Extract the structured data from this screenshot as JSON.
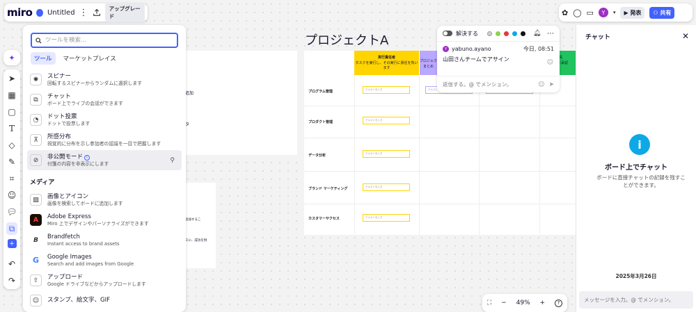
{
  "app": {
    "logo": "miro",
    "board_title": "Untitled",
    "upgrade_label": "アップグレード"
  },
  "topright": {
    "avatar_letter": "Y",
    "present_label": "発表",
    "share_label": "共有"
  },
  "tools": {
    "search_placeholder": "ツールを検索...",
    "tabs": [
      "ツール",
      "マーケットプレイス"
    ],
    "items": [
      {
        "name": "スピナー",
        "desc": "回転するスピナーからランダムに選択します",
        "icon": "spinner-icon"
      },
      {
        "name": "チャット",
        "desc": "ボード上でライブの会話ができます",
        "icon": "chat-icon"
      },
      {
        "name": "ドット投票",
        "desc": "ドットで投票します",
        "icon": "dot-vote-icon"
      },
      {
        "name": "所感分布",
        "desc": "視覚的に分布を示し参加者の認識を一目で把握します",
        "icon": "distribution-icon"
      },
      {
        "name": "非公開モード",
        "desc": "付箋の内容を非表示にします",
        "icon": "private-mode-icon"
      }
    ],
    "media_heading": "メディア",
    "media": [
      {
        "name": "画像とアイコン",
        "desc": "画像を検索してボードに追加します",
        "icon": "image-icon"
      },
      {
        "name": "Adobe Express",
        "desc": "Miro 上でデザインやパーソナライズができます",
        "icon": "adobe-icon"
      },
      {
        "name": "Brandfetch",
        "desc": "Instant access to brand assets",
        "icon": "brandfetch-icon"
      },
      {
        "name": "Google Images",
        "desc": "Search and add images from Google",
        "icon": "google-icon"
      },
      {
        "name": "アップロード",
        "desc": "Google ドライブなどからアップロードします",
        "icon": "upload-icon"
      },
      {
        "name": "スタンプ、絵文字、GIF",
        "desc": "",
        "icon": "stamp-icon"
      }
    ]
  },
  "board": {
    "headline": "プロジェクトA",
    "column_headers": [
      {
        "title": "実行責任者",
        "desc": "タスクを実行し、その実行に責任を負います",
        "color": "#ffd400"
      },
      {
        "title": "プロジェク",
        "desc": "まとめ",
        "color": "#b9a8ff"
      },
      {
        "title": "報告先",
        "desc": "最終的に承認",
        "color": "#20c35e"
      }
    ],
    "rows": [
      "プログラム管理",
      "プロダクト管理",
      "データ分析",
      "ブランド マーケティング",
      "カスタマーサクセス"
    ],
    "sticky_text": "テキストを入力",
    "left_card_texts": [
      "追加",
      "タ"
    ],
    "left_card2_texts": [
      "追加するこ",
      "スに、成功を例"
    ]
  },
  "comment": {
    "resolve_label": "解決する",
    "colors": [
      "#d0d0d0",
      "#8fd14f",
      "#e6393b",
      "#0ca9e6",
      "#111111"
    ],
    "user": "yabuno.ayano",
    "user_initial": "Y",
    "time": "今日, 08:51",
    "message": "山田さんチームでアサイン",
    "reply_placeholder": "返信する。@ でメンション。"
  },
  "chat": {
    "title": "チャット",
    "heading": "ボード上でチャット",
    "subtitle": "ボードに直接チャットの記録を残すことができます。",
    "date": "2025年3月26日",
    "input_placeholder": "メッセージを入力。@ でメンション。"
  },
  "zoom": {
    "level": "49%",
    "help": "?"
  }
}
